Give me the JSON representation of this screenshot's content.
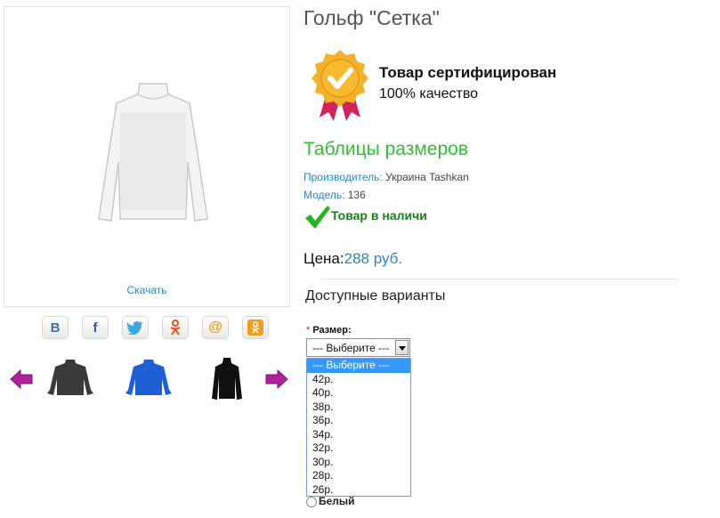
{
  "product": {
    "title": "Гольф \"Сетка\"",
    "download_label": "Скачать"
  },
  "social_icons": [
    "vkontakte-icon",
    "facebook-icon",
    "twitter-icon",
    "odnoklassniki-person-icon",
    "mailru-icon",
    "odnoklassniki-icon"
  ],
  "social_labels": {
    "vk": "B",
    "fb": "f"
  },
  "certificate": {
    "title": "Товар сертифицирован",
    "subtitle": "100% качество"
  },
  "size_tables_link": "Таблицы размеров",
  "manufacturer": {
    "label": "Производитель:",
    "value": "Украина Tashkan"
  },
  "model": {
    "label": "Модель:",
    "value": "136"
  },
  "stock_status": "Товар в наличи",
  "price": {
    "label": "Цена:",
    "value": "288 руб."
  },
  "available_options_title": "Доступные варианты",
  "size_field": {
    "required_mark": "*",
    "label": "Размер:",
    "selected": "--- Выберите ---",
    "options": [
      "--- Выберите ---",
      "42р.",
      "40р.",
      "38р.",
      "36р.",
      "34р.",
      "32р.",
      "30р.",
      "28р.",
      "26р."
    ]
  },
  "color_option_partial": "Белый",
  "colors": {
    "link": "#2a86c6",
    "green": "#2fbf2f",
    "highlight": "#3399ff",
    "arrow": "#b0209a"
  }
}
